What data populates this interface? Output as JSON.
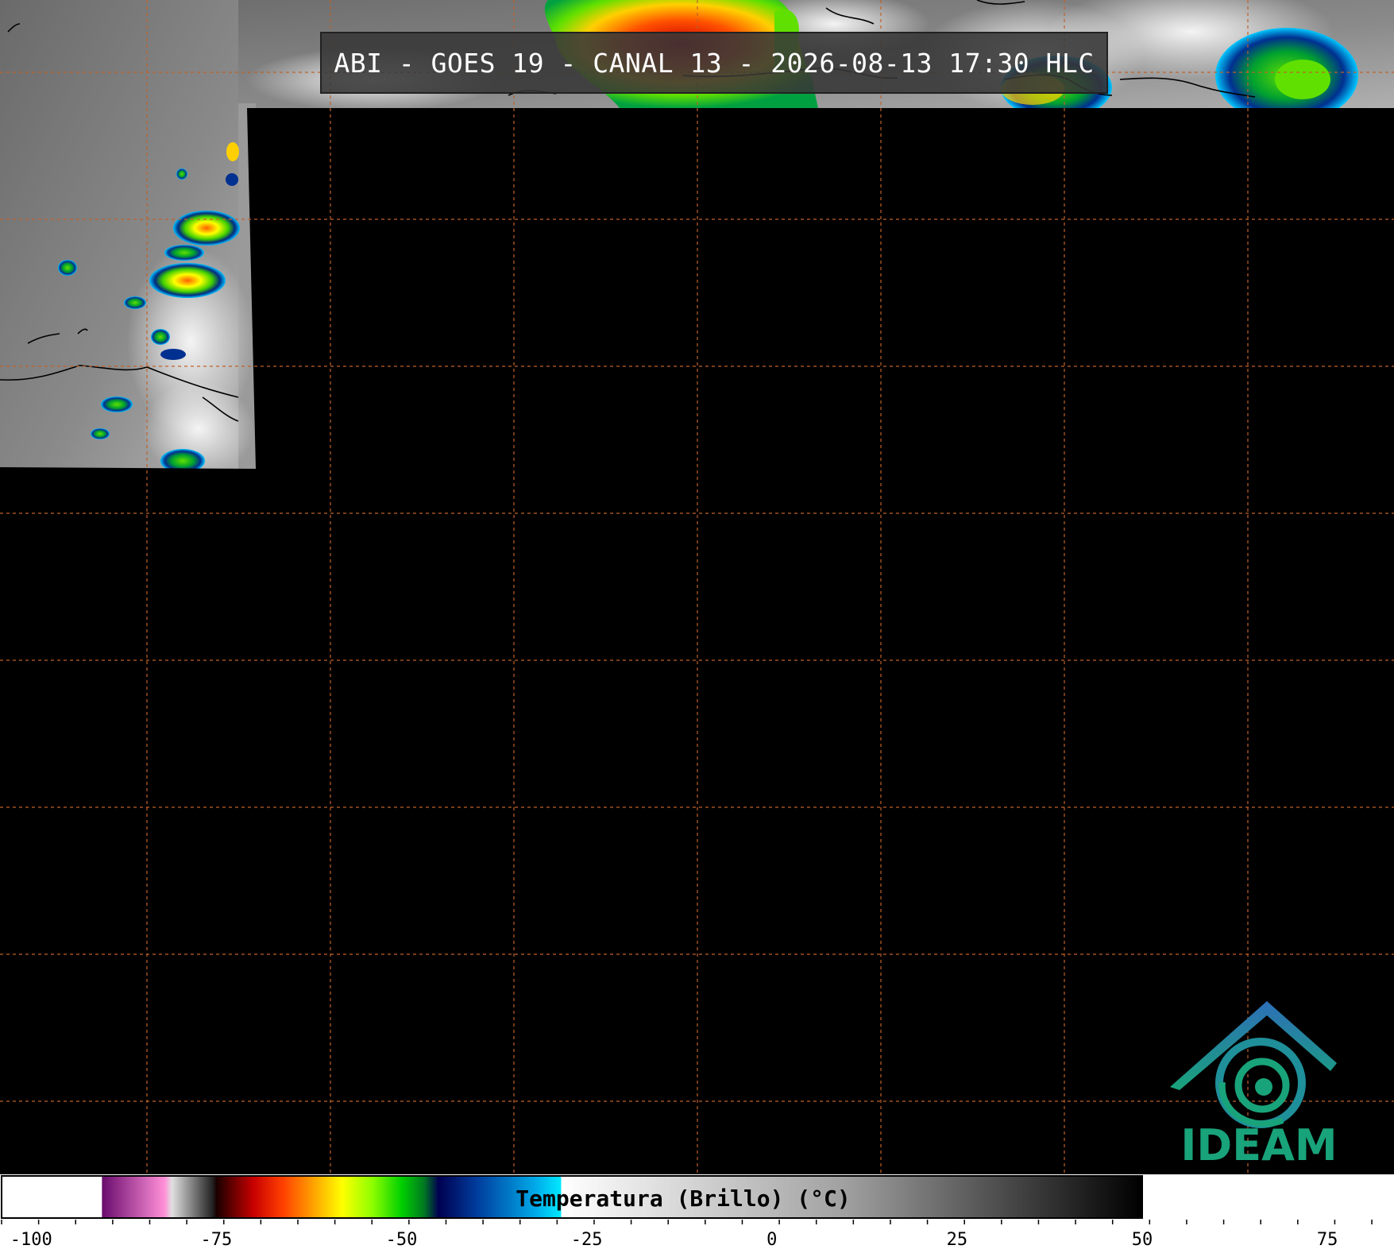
{
  "title": "ABI - GOES 19 - CANAL 13 - 2026-08-13 17:30 HLC",
  "colorbar": {
    "label": "Temperatura (Brillo) (°C)",
    "unit": "°C",
    "range": [
      -104,
      84
    ],
    "ticks": [
      "-100",
      "-75",
      "-50",
      "-25",
      "0",
      "25",
      "50",
      "75"
    ],
    "tick_values": [
      -100,
      -75,
      -50,
      -25,
      0,
      25,
      50,
      75
    ],
    "stops": [
      {
        "t": -104,
        "color": "#ffffff"
      },
      {
        "t": -90.5,
        "color": "#ffffff"
      },
      {
        "t": -90.4,
        "color": "#6a0d6e"
      },
      {
        "t": -82,
        "color": "#ff8fd8"
      },
      {
        "t": -81,
        "color": "#e0e0e0"
      },
      {
        "t": -75.5,
        "color": "#222222"
      },
      {
        "t": -75,
        "color": "#1a0000"
      },
      {
        "t": -70,
        "color": "#c80000"
      },
      {
        "t": -66,
        "color": "#ff4000"
      },
      {
        "t": -62,
        "color": "#ffa000"
      },
      {
        "t": -58,
        "color": "#ffff00"
      },
      {
        "t": -54,
        "color": "#90ff00"
      },
      {
        "t": -50,
        "color": "#00d000"
      },
      {
        "t": -47,
        "color": "#007a20"
      },
      {
        "t": -45,
        "color": "#000050"
      },
      {
        "t": -40,
        "color": "#003a9a"
      },
      {
        "t": -32,
        "color": "#00a8e8"
      },
      {
        "t": -28.5,
        "color": "#00e8ff"
      },
      {
        "t": -28.4,
        "color": "#ffffff"
      },
      {
        "t": 10,
        "color": "#a0a0a0"
      },
      {
        "t": 50,
        "color": "#000000"
      },
      {
        "t": 84,
        "color": "#000000"
      }
    ]
  },
  "logo": {
    "text": "IDEAM",
    "color": "#19a37a"
  },
  "colors": {
    "grid": "#c0622a",
    "background": "#000000"
  }
}
